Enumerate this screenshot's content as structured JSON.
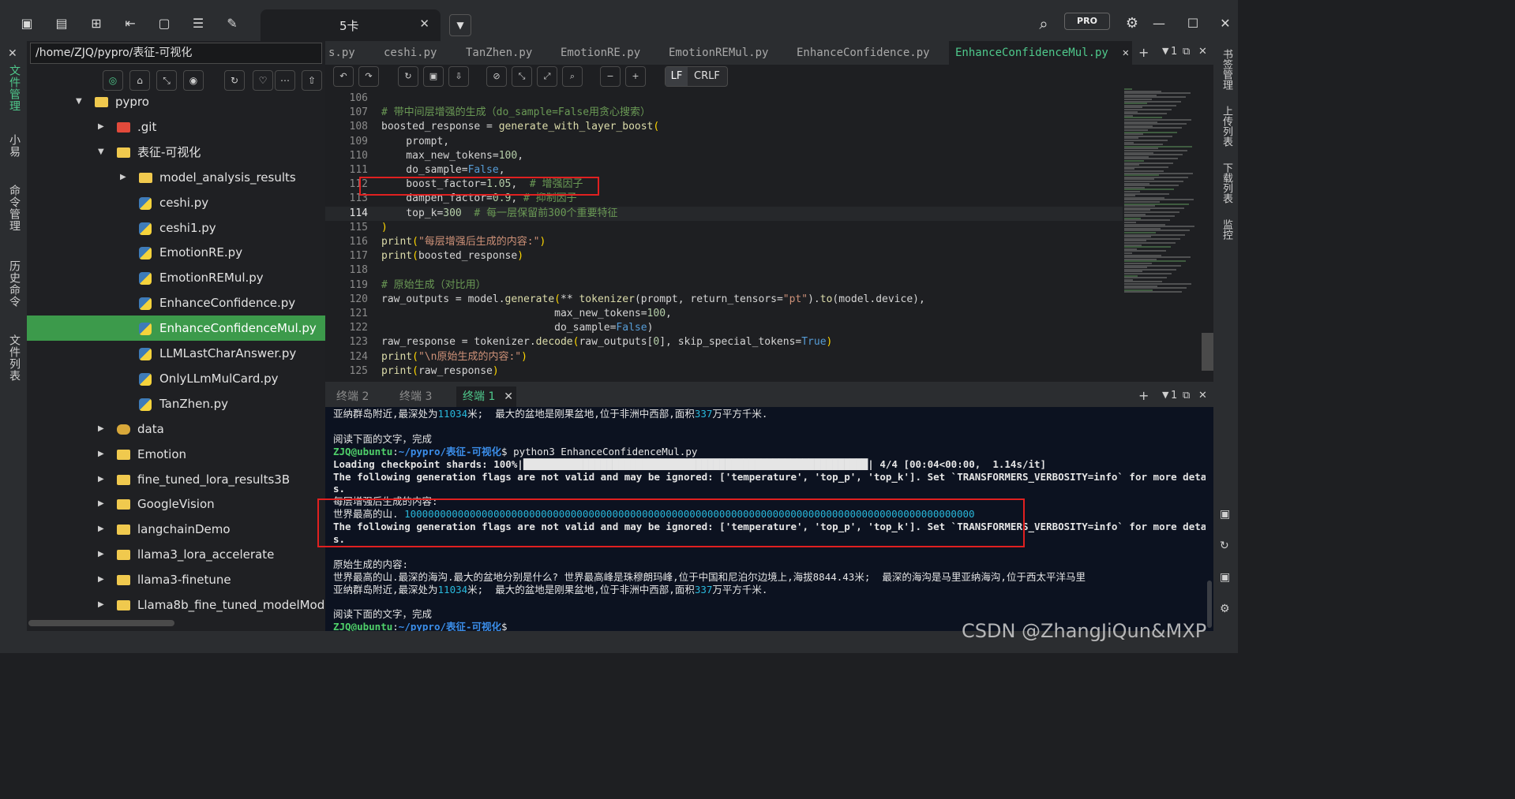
{
  "session_tab": {
    "title": "5卡"
  },
  "pro_badge": "PRO",
  "left_rail": [
    "文件管理",
    "小易",
    "命令管理",
    "历史命令",
    "文件列表"
  ],
  "right_rail": [
    "书签管理",
    "上传列表",
    "下载列表",
    "监控"
  ],
  "file_panel": {
    "path": "/home/ZJQ/pypro/表征-可视化",
    "tree": [
      {
        "label": "pypro",
        "type": "folder",
        "depth": 0,
        "arrow": "▼"
      },
      {
        "label": ".git",
        "type": "git",
        "depth": 1,
        "arrow": "▶"
      },
      {
        "label": "表征-可视化",
        "type": "folder",
        "depth": 1,
        "arrow": "▼"
      },
      {
        "label": "model_analysis_results",
        "type": "folder",
        "depth": 2,
        "arrow": "▶"
      },
      {
        "label": "ceshi.py",
        "type": "py",
        "depth": 2,
        "arrow": ""
      },
      {
        "label": "ceshi1.py",
        "type": "py",
        "depth": 2,
        "arrow": ""
      },
      {
        "label": "EmotionRE.py",
        "type": "py",
        "depth": 2,
        "arrow": ""
      },
      {
        "label": "EmotionREMul.py",
        "type": "py",
        "depth": 2,
        "arrow": ""
      },
      {
        "label": "EnhanceConfidence.py",
        "type": "py",
        "depth": 2,
        "arrow": ""
      },
      {
        "label": "EnhanceConfidenceMul.py",
        "type": "py",
        "depth": 2,
        "arrow": "",
        "selected": true
      },
      {
        "label": "LLMLastCharAnswer.py",
        "type": "py",
        "depth": 2,
        "arrow": ""
      },
      {
        "label": "OnlyLLmMulCard.py",
        "type": "py",
        "depth": 2,
        "arrow": ""
      },
      {
        "label": "TanZhen.py",
        "type": "py",
        "depth": 2,
        "arrow": ""
      },
      {
        "label": "data",
        "type": "db",
        "depth": 1,
        "arrow": "▶"
      },
      {
        "label": "Emotion",
        "type": "folder",
        "depth": 1,
        "arrow": "▶"
      },
      {
        "label": "fine_tuned_lora_results3B",
        "type": "folder",
        "depth": 1,
        "arrow": "▶"
      },
      {
        "label": "GoogleVision",
        "type": "folder",
        "depth": 1,
        "arrow": "▶"
      },
      {
        "label": "langchainDemo",
        "type": "folder",
        "depth": 1,
        "arrow": "▶"
      },
      {
        "label": "llama3_lora_accelerate",
        "type": "folder",
        "depth": 1,
        "arrow": "▶"
      },
      {
        "label": "llama3-finetune",
        "type": "folder",
        "depth": 1,
        "arrow": "▶"
      },
      {
        "label": "Llama8b_fine_tuned_modelMode",
        "type": "folder",
        "depth": 1,
        "arrow": "▶"
      }
    ]
  },
  "editor_tabs": [
    "s.py",
    "ceshi.py",
    "TanZhen.py",
    "EmotionRE.py",
    "EmotionREMul.py",
    "EnhanceConfidence.py",
    "EnhanceConfidenceMul.py"
  ],
  "editor_active_tab": "EnhanceConfidenceMul.py",
  "pane_counter": "1",
  "lf": "LF",
  "crlf": "CRLF",
  "code_lines": [
    {
      "n": "106",
      "html": ""
    },
    {
      "n": "107",
      "html": "<span class='cmt'># 带中间层增强的生成（do_sample=False用贪心搜索）</span>"
    },
    {
      "n": "108",
      "html": "boosted_response = <span class='fn'>generate_with_layer_boost</span><span class='pr'>(</span>"
    },
    {
      "n": "109",
      "html": "    prompt,"
    },
    {
      "n": "110",
      "html": "    max_new_tokens=<span class='num'>100</span>,"
    },
    {
      "n": "111",
      "html": "    do_sample=<span class='kw'>False</span>,"
    },
    {
      "n": "112",
      "html": "    boost_factor=<span class='num'>1.05</span>,  <span class='cmt'># 增强因子</span>"
    },
    {
      "n": "113",
      "html": "    dampen_factor=<span class='num'>0.9</span>, <span class='cmt'># 抑制因子</span>"
    },
    {
      "n": "114",
      "html": "    top_k=<span class='num'>300</span>  <span class='cmt'># 每一层保留前300个重要特征</span>"
    },
    {
      "n": "115",
      "html": "<span class='pr'>)</span>"
    },
    {
      "n": "116",
      "html": "<span class='fn'>print</span><span class='pr'>(</span><span class='str'>\"每层增强后生成的内容:\"</span><span class='pr'>)</span>"
    },
    {
      "n": "117",
      "html": "<span class='fn'>print</span><span class='pr'>(</span>boosted_response<span class='pr'>)</span>"
    },
    {
      "n": "118",
      "html": ""
    },
    {
      "n": "119",
      "html": "<span class='cmt'># 原始生成（对比用）</span>"
    },
    {
      "n": "120",
      "html": "raw_outputs = model.<span class='fn'>generate</span><span class='pr'>(</span>** <span class='fn'>tokenizer</span>(prompt, return_tensors=<span class='str'>\"pt\"</span>).<span class='fn'>to</span>(model.device),"
    },
    {
      "n": "121",
      "html": "                            max_new_tokens=<span class='num'>100</span>,"
    },
    {
      "n": "122",
      "html": "                            do_sample=<span class='kw'>False</span>)"
    },
    {
      "n": "123",
      "html": "raw_response = tokenizer.<span class='fn'>decode</span><span class='pr'>(</span>raw_outputs[<span class='num'>0</span>], skip_special_tokens=<span class='kw'>True</span><span class='pr'>)</span>"
    },
    {
      "n": "124",
      "html": "<span class='fn'>print</span><span class='pr'>(</span><span class='str'>\"\\n原始生成的内容:\"</span><span class='pr'>)</span>"
    },
    {
      "n": "125",
      "html": "<span class='fn'>print</span><span class='pr'>(</span>raw_response<span class='pr'>)</span>"
    }
  ],
  "current_line": "114",
  "terminal_tabs": [
    "终端 2",
    "终端 3",
    "终端 1"
  ],
  "terminal_active_tab": "终端 1",
  "terminal_lines": [
    "亚纳群岛附近,最深处为<span class='cy'>11034</span>米;  最大的盆地是刚果盆地,位于非洲中西部,面积<span class='cy'>337</span>万平方千米.",
    "",
    "阅读下面的文字，完成",
    "<span class='u'>ZJQ@ubuntu</span>:<span class='p'>~/pypro/表征-可视化</span>$ python3 EnhanceConfidenceMul.py",
    "<b>Loading checkpoint shards: 100%|██████████████████████████████████████████████████████████| 4/4 [00:04&lt;00:00,  1.14s/it]</b>",
    "<b>The following generation flags are not valid and may be ignored: ['temperature', 'top_p', 'top_k']. Set `TRANSFORMERS_VERBOSITY=info` for more detail</b>",
    "<b>s.</b>",
    "每层增强后生成的内容:",
    "世界最高的山. <span class='cy'>100000000000000000000000000000000000000000000000000000000000000000000000000000000000000000000000</span>",
    "<b>The following generation flags are not valid and may be ignored: ['temperature', 'top_p', 'top_k']. Set `TRANSFORMERS_VERBOSITY=info` for more detail</b>",
    "<b>s.</b>",
    "",
    "原始生成的内容:",
    "世界最高的山.最深的海沟.最大的盆地分别是什么? 世界最高峰是珠穆朗玛峰,位于中国和尼泊尔边境上,海拔8844.43米;  最深的海沟是马里亚纳海沟,位于西太平洋马里",
    "亚纳群岛附近,最深处为<span class='cy'>11034</span>米;  最大的盆地是刚果盆地,位于非洲中西部,面积<span class='cy'>337</span>万平方千米.",
    "",
    "阅读下面的文字，完成",
    "<span class='u'>ZJQ@ubuntu</span>:<span class='p'>~/pypro/表征-可视化</span>$ "
  ],
  "watermark": "CSDN @ZhangJiQun&MXP"
}
